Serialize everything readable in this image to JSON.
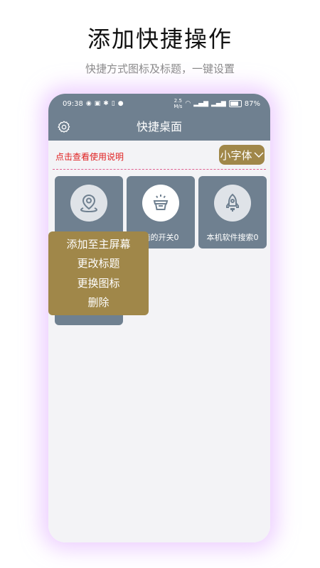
{
  "promo": {
    "title": "添加快捷操作",
    "subtitle": "快捷方式图标及标题，一键设置"
  },
  "status_bar": {
    "time": "09:38",
    "network_speed": "2.5",
    "network_unit": "M/s",
    "battery": "87%"
  },
  "app_bar": {
    "title": "快捷桌面"
  },
  "toolbar": {
    "help_link": "点击查看使用说明",
    "font_size_selected": "小字体"
  },
  "tiles": [
    {
      "label": "",
      "icon": "map-pin-icon"
    },
    {
      "label": "简的开关0",
      "icon": "basket-icon"
    },
    {
      "label": "本机软件搜索0",
      "icon": "rocket-icon"
    }
  ],
  "context_menu": {
    "items": [
      "添加至主屏幕",
      "更改标题",
      "更换图标",
      "删除"
    ]
  },
  "colors": {
    "primary": "#6f8090",
    "accent_gold": "#a08749",
    "link_red": "#e02020",
    "page_bg": "#f3f3f6"
  }
}
